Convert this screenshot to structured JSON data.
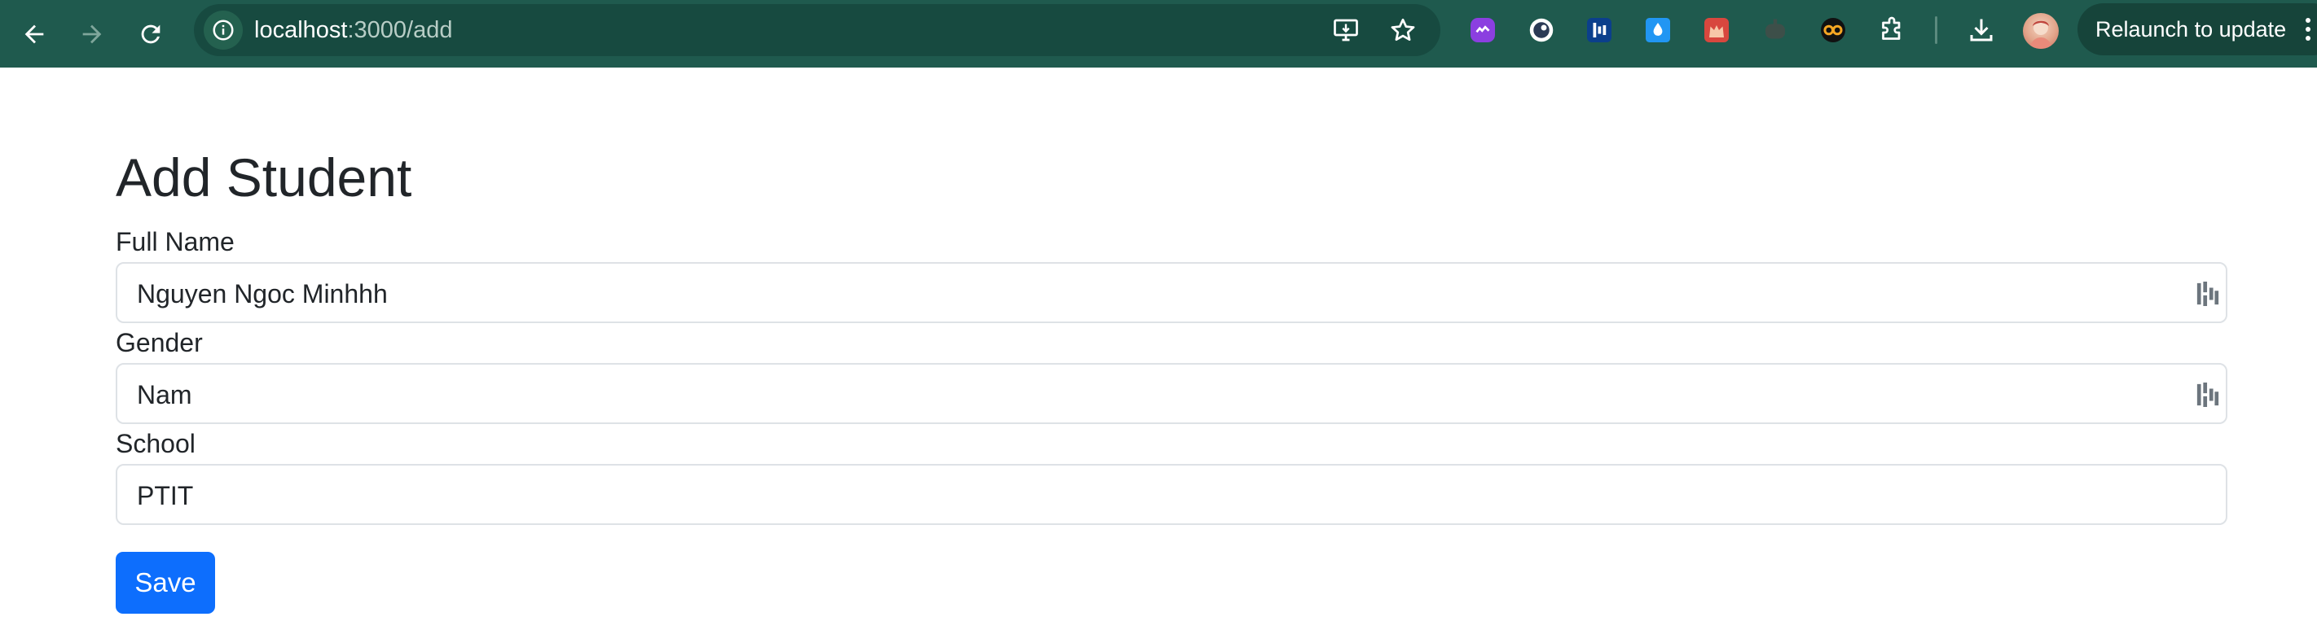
{
  "browser": {
    "url_host": "localhost",
    "url_path": ":3000/add",
    "relaunch_label": "Relaunch to update",
    "icons": {
      "back": "arrow-left-icon",
      "forward": "arrow-right-icon",
      "reload": "reload-icon",
      "site_info": "info-icon",
      "install": "install-app-icon",
      "bookmark": "star-icon",
      "extensions": "puzzle-icon",
      "downloads": "download-icon",
      "menu": "kebab-menu-icon"
    },
    "extensions": [
      "purple-link-extension",
      "face-extension",
      "blue-chart-extension",
      "droplet-extension",
      "red-cat-extension",
      "gray-bot-extension",
      "cc-extension"
    ],
    "colors": {
      "toolbar": "#1f5a4e",
      "omnibox": "#174a40"
    }
  },
  "page": {
    "title": "Add Student",
    "fields": [
      {
        "label": "Full Name",
        "value": "Nguyen Ngoc Minhhh",
        "has_password_icon": true
      },
      {
        "label": "Gender",
        "value": "Nam",
        "has_password_icon": true
      },
      {
        "label": "School",
        "value": "PTIT",
        "has_password_icon": false
      }
    ],
    "save_label": "Save",
    "colors": {
      "primary": "#0d6efd",
      "text": "#212529",
      "border": "#dee2e6"
    }
  }
}
